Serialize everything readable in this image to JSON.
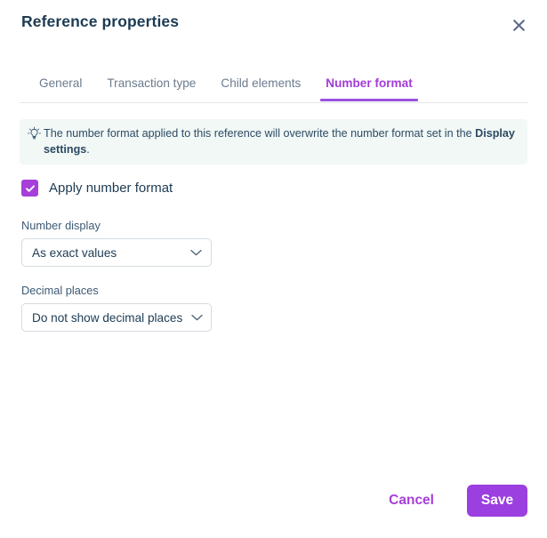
{
  "dialog": {
    "title": "Reference properties",
    "close_icon": "close-icon"
  },
  "tabs": [
    {
      "label": "General",
      "active": false
    },
    {
      "label": "Transaction type",
      "active": false
    },
    {
      "label": "Child elements",
      "active": false
    },
    {
      "label": "Number format",
      "active": true
    }
  ],
  "info_banner": {
    "icon": "lightbulb-icon",
    "text_before": "The number format applied to this reference will overwrite the number format set in the ",
    "text_bold": "Display settings",
    "text_after": "."
  },
  "apply_checkbox": {
    "label": "Apply number format",
    "checked": true
  },
  "fields": {
    "number_display": {
      "label": "Number display",
      "value": "As exact values"
    },
    "decimal_places": {
      "label": "Decimal places",
      "value": "Do not show decimal places"
    }
  },
  "footer": {
    "cancel_label": "Cancel",
    "save_label": "Save"
  },
  "colors": {
    "accent_purple": "#9b3fe0",
    "tab_active": "#a23bd6",
    "title_text": "#1d3b53",
    "banner_bg": "#f1f8f6",
    "muted_text": "#6b7b8d"
  }
}
